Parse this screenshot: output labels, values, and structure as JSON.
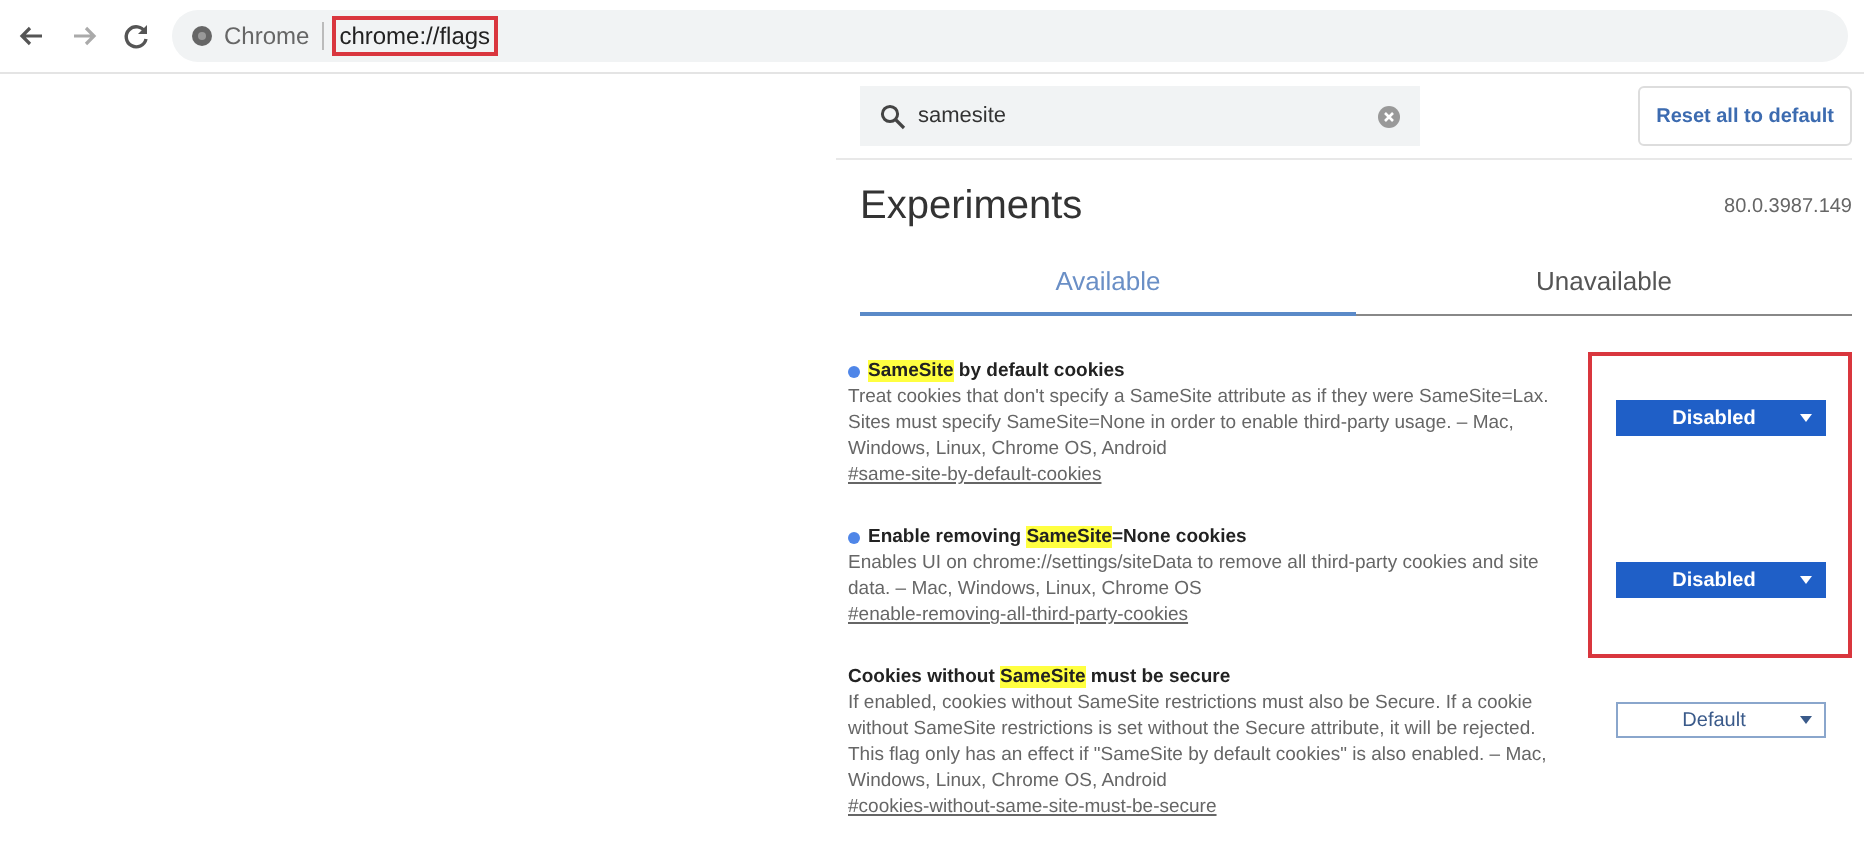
{
  "toolbar": {
    "site_label": "Chrome",
    "url": "chrome://flags",
    "url_annotated": true
  },
  "search": {
    "value": "samesite"
  },
  "reset_button": "Reset all to default",
  "title": "Experiments",
  "version": "80.0.3987.149",
  "tabs": [
    {
      "label": "Available",
      "selected": true
    },
    {
      "label": "Unavailable",
      "selected": false
    }
  ],
  "flags": [
    {
      "title": [
        {
          "text": "SameSite",
          "highlight": true
        },
        {
          "text": " by default cookies",
          "highlight": false
        }
      ],
      "description": "Treat cookies that don't specify a SameSite attribute as if they were SameSite=Lax. Sites must specify SameSite=None in order to enable third-party usage. – Mac, Windows, Linux, Chrome OS, Android",
      "link": "#same-site-by-default-cookies",
      "value": "Disabled",
      "modified": true,
      "annotated": true
    },
    {
      "title": [
        {
          "text": "Enable removing ",
          "highlight": false
        },
        {
          "text": "SameSite",
          "highlight": true
        },
        {
          "text": "=None cookies",
          "highlight": false
        }
      ],
      "description": "Enables UI on chrome://settings/siteData to remove all third-party cookies and site data. – Mac, Windows, Linux, Chrome OS",
      "link": "#enable-removing-all-third-party-cookies",
      "value": "Disabled",
      "modified": true,
      "annotated": true
    },
    {
      "title": [
        {
          "text": "Cookies without ",
          "highlight": false
        },
        {
          "text": "SameSite",
          "highlight": true
        },
        {
          "text": " must be secure",
          "highlight": false
        }
      ],
      "description": "If enabled, cookies without SameSite restrictions must also be Secure. If a cookie without SameSite restrictions is set without the Secure attribute, it will be rejected. This flag only has an effect if \"SameSite by default cookies\" is also enabled. – Mac, Windows, Linux, Chrome OS, Android",
      "link": "#cookies-without-same-site-must-be-secure",
      "value": "Default",
      "modified": false,
      "annotated": false
    }
  ]
}
